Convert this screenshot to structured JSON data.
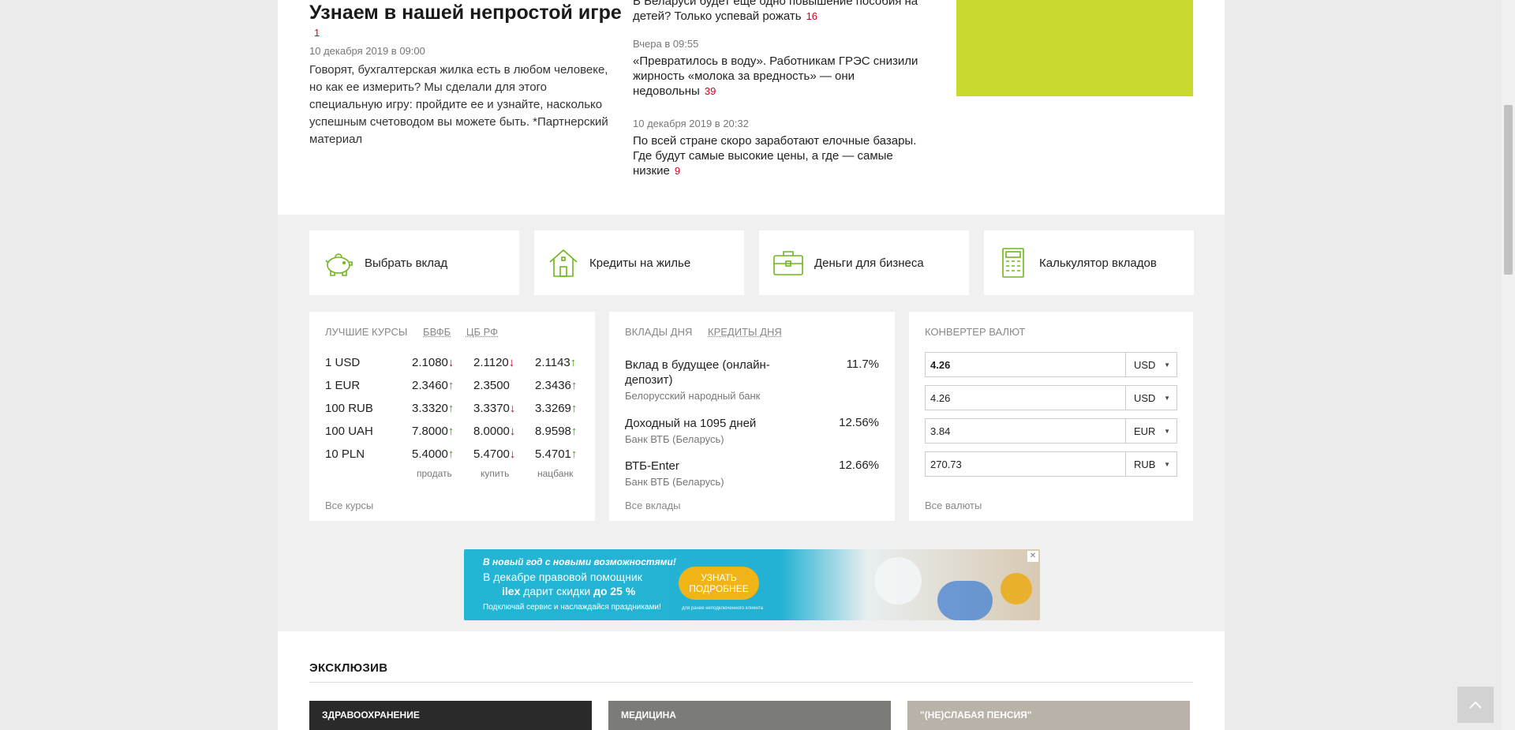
{
  "featured": {
    "title": "Узнаем в нашей непростой игре",
    "comments": "1",
    "date": "10 декабря 2019 в 09:00",
    "text": "Говорят, бухгалтерская жилка есть в любом человеке, но как ее измерить? Мы сделали для этого специальную игру: пройдите ее и узнайте, насколько успешным счетоводом вы можете быть. *Партнерский материал"
  },
  "news": [
    {
      "date": "",
      "text": "В Беларуси будет еще одно повышение пособия на детей? Только успевай рожать",
      "comments": "16"
    },
    {
      "date": "Вчера в 09:55",
      "text": "«Превратилось в воду». Работникам ГРЭС снизили жирность «молока за вредность» — они недовольны",
      "comments": "39"
    },
    {
      "date": "10 декабря 2019 в 20:32",
      "text": "По всей стране скоро заработают елочные базары. Где будут самые высокие цены, а где — самые низкие",
      "comments": "9"
    }
  ],
  "quick_links": [
    {
      "label": "Выбрать вклад",
      "icon": "piggy-bank-icon"
    },
    {
      "label": "Кредиты на жилье",
      "icon": "house-icon"
    },
    {
      "label": "Деньги для бизнеса",
      "icon": "briefcase-icon"
    },
    {
      "label": "Калькулятор вкладов",
      "icon": "calculator-icon"
    }
  ],
  "rates": {
    "tabs": [
      "ЛУЧШИЕ КУРСЫ",
      "БВФБ",
      "ЦБ РФ"
    ],
    "rows": [
      {
        "cur": "1 USD",
        "sell": "2.1080",
        "sell_dir": "down",
        "buy": "2.1120",
        "buy_dir": "down",
        "nb": "2.1143",
        "nb_dir": "up"
      },
      {
        "cur": "1 EUR",
        "sell": "2.3460",
        "sell_dir": "up",
        "buy": "2.3500",
        "buy_dir": "",
        "nb": "2.3436",
        "nb_dir": "up"
      },
      {
        "cur": "100 RUB",
        "sell": "3.3320",
        "sell_dir": "up",
        "buy": "3.3370",
        "buy_dir": "down",
        "nb": "3.3269",
        "nb_dir": "up"
      },
      {
        "cur": "100 UAH",
        "sell": "7.8000",
        "sell_dir": "up",
        "buy": "8.0000",
        "buy_dir": "down",
        "nb": "8.9598",
        "nb_dir": "up"
      },
      {
        "cur": "10 PLN",
        "sell": "5.4000",
        "sell_dir": "up",
        "buy": "5.4700",
        "buy_dir": "down",
        "nb": "5.4701",
        "nb_dir": "up"
      }
    ],
    "labels": {
      "sell": "продать",
      "buy": "купить",
      "nb": "нацбанк"
    },
    "footer": "Все курсы"
  },
  "deposits": {
    "tabs": [
      "ВКЛАДЫ ДНЯ",
      "КРЕДИТЫ ДНЯ"
    ],
    "items": [
      {
        "name": "Вклад в будущее (онлайн-депозит)",
        "bank": "Белорусский народный банк",
        "rate": "11.7%"
      },
      {
        "name": "Доходный на 1095 дней",
        "bank": "Банк ВТБ (Беларусь)",
        "rate": "12.56%"
      },
      {
        "name": "ВТБ-Enter",
        "bank": "Банк ВТБ (Беларусь)",
        "rate": "12.66%"
      }
    ],
    "footer": "Все вклады"
  },
  "converter": {
    "title": "КОНВЕРТЕР ВАЛЮТ",
    "rows": [
      {
        "value": "4.26",
        "currency": "USD"
      },
      {
        "value": "4.26",
        "currency": "USD"
      },
      {
        "value": "3.84",
        "currency": "EUR"
      },
      {
        "value": "270.73",
        "currency": "RUB"
      }
    ],
    "footer": "Все валюты"
  },
  "banner": {
    "line1": "В новый год с новыми возможностями!",
    "line2": "В декабре правовой помощник",
    "line3_brand": "ilex",
    "line3_rest": " дарит скидки ",
    "line3_bold": "до 25 %",
    "line4": "Подключай сервис и наслаждайся праздниками!",
    "button": "УЗНАТЬ ПОДРОБНЕЕ",
    "small": "для ранее неподключенного клиента"
  },
  "exclusive": {
    "title": "ЭКСКЛЮЗИВ",
    "cards": [
      {
        "tag": "ЗДРАВООХРАНЕНИЕ"
      },
      {
        "tag": "МЕДИЦИНА"
      },
      {
        "tag": "\"(НЕ)СЛАБАЯ ПЕНСИЯ\""
      }
    ]
  },
  "colors": {
    "accent_green": "#6fb51e",
    "red": "#d0021b",
    "ad_green": "#c9d92f"
  }
}
